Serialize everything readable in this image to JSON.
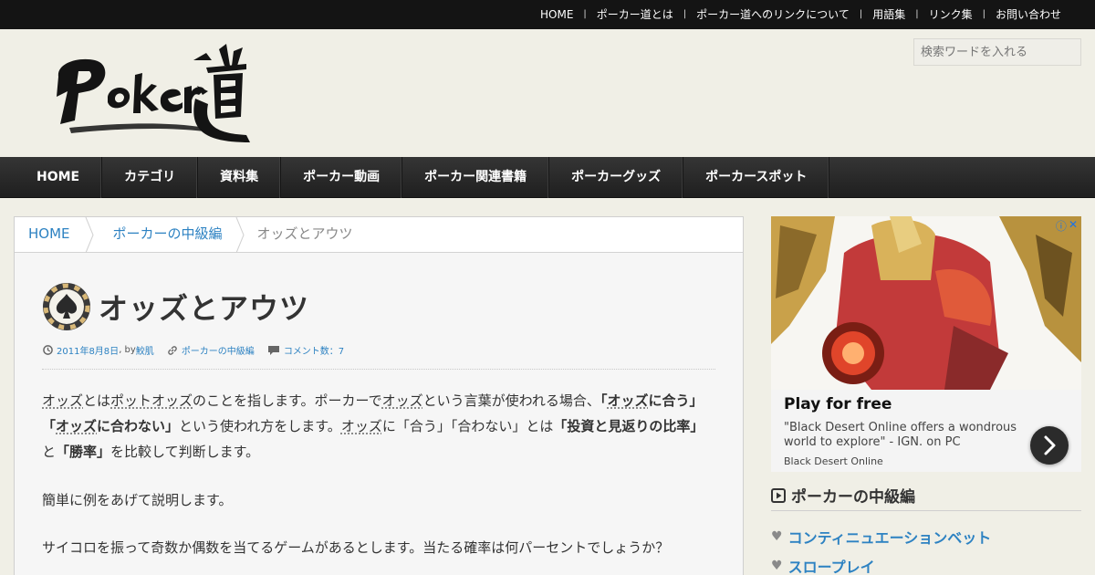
{
  "topnav": [
    "HOME",
    "ポーカー道とは",
    "ポーカー道へのリンクについて",
    "用語集",
    "リンク集",
    "お問い合わせ"
  ],
  "logo_text": "Poker道",
  "search": {
    "placeholder": "検索ワードを入れる"
  },
  "mainnav": [
    "HOME",
    "カテゴリ",
    "資料集",
    "ポーカー動画",
    "ポーカー関連書籍",
    "ポーカーグッズ",
    "ポーカースポット"
  ],
  "breadcrumb": [
    "HOME",
    "ポーカーの中級編",
    "オッズとアウツ"
  ],
  "article": {
    "title": "オッズとアウツ",
    "date": "2011年8月8日",
    "by": " , by ",
    "author": "鮫肌",
    "category": "ポーカーの中級編",
    "comments": "コメント数：7",
    "p1": [
      {
        "t": "オッズ",
        "s": "u"
      },
      {
        "t": "とは",
        "s": ""
      },
      {
        "t": "ポットオッズ",
        "s": "u"
      },
      {
        "t": "のことを指します。ポーカーで",
        "s": ""
      },
      {
        "t": "オッズ",
        "s": "u"
      },
      {
        "t": "という言葉が使われる場合、",
        "s": ""
      },
      {
        "t": "「",
        "s": "b"
      },
      {
        "t": "オッズ",
        "s": "bu"
      },
      {
        "t": "に合う」「",
        "s": "b"
      },
      {
        "t": "オッズ",
        "s": "bu"
      },
      {
        "t": "に合わない」",
        "s": "b"
      },
      {
        "t": "という使われ方をします。",
        "s": ""
      },
      {
        "t": "オッズ",
        "s": "u"
      },
      {
        "t": "に「合う」「合わない」とは",
        "s": ""
      },
      {
        "t": "「投資と見返りの比率」",
        "s": "b"
      },
      {
        "t": "と",
        "s": ""
      },
      {
        "t": "「勝率」",
        "s": "b"
      },
      {
        "t": "を比較して判断します。",
        "s": ""
      }
    ],
    "p2": "簡単に例をあげて説明します。",
    "p3": "サイコロを振って奇数か偶数を当てるゲームがあるとします。当たる確率は何パーセントでしょうか？"
  },
  "ad": {
    "title": "Play for free",
    "desc": "\"Black Desert Online offers a wondrous world to explore\" - IGN. on PC",
    "source": "Black Desert Online"
  },
  "sidebar": {
    "widget_title": "ポーカーの中級編",
    "items": [
      "コンティニュエーションベット",
      "スロープレイ"
    ]
  }
}
